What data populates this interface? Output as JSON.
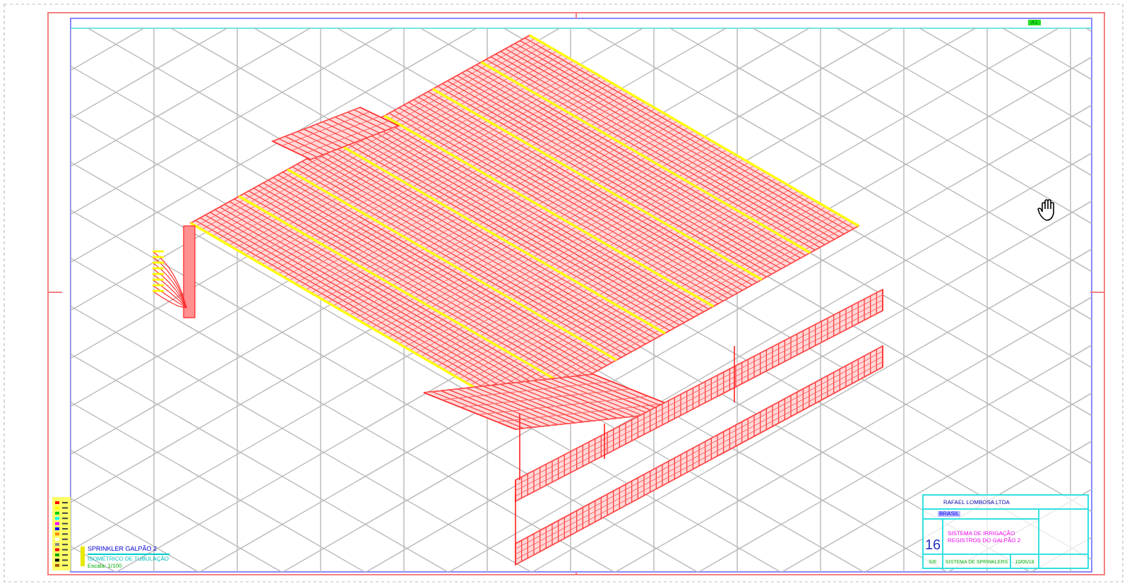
{
  "sheet_tag": "A1",
  "drawing_label": {
    "title": "SPRINKLER GALPÃO 2",
    "subtitle": "ISOMÉTRICO DE TUBULAÇÃO",
    "scale": "Escala: 1/100"
  },
  "title_block": {
    "company": "RAFAEL LOMBOSA LTDA",
    "client": "BRASIL",
    "sheet_number": "16",
    "drawing_title": [
      "SISTEMA DE IRRIGAÇÃO",
      "REGISTROS DO GALPÃO 2"
    ],
    "footer": [
      "S/E",
      "SISTEMA DE SPRINKLERS",
      "10/05/18"
    ]
  }
}
